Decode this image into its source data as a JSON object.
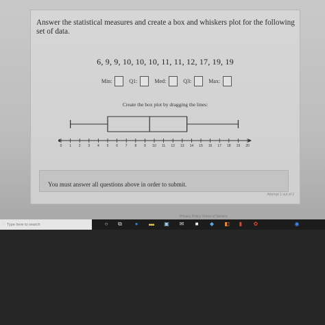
{
  "question": {
    "prompt": "Answer the statistical measures and create a box and whiskers plot for the following set of data.",
    "dataset": "6, 9, 9, 10, 10, 10, 11, 11, 12, 17, 19, 19"
  },
  "measures": {
    "min_label": "Min:",
    "q1_label": "Q1:",
    "med_label": "Med:",
    "q3_label": "Q3:",
    "max_label": "Max:",
    "min_value": "",
    "q1_value": "",
    "med_value": "",
    "q3_value": "",
    "max_value": ""
  },
  "plot": {
    "instruction": "Create the box plot by dragging the lines:",
    "axis_min": 0,
    "axis_max": 20,
    "ticks": [
      "0",
      "1",
      "2",
      "3",
      "4",
      "5",
      "6",
      "7",
      "8",
      "9",
      "10",
      "11",
      "12",
      "13",
      "14",
      "15",
      "16",
      "17",
      "18",
      "19",
      "20"
    ],
    "whisker_min": 1,
    "q1": 5,
    "median": 9.5,
    "q3": 13.5,
    "whisker_max": 19
  },
  "notice": {
    "text": "You must answer all questions above in order to submit."
  },
  "attempt": "Attempt 1 out of 2",
  "footer": "Privacy Policy   Terms of Service",
  "taskbar": {
    "search_placeholder": "Type here to search",
    "icons": [
      "windows-icon",
      "search-icon",
      "cortana-icon",
      "task-view-icon",
      "edge-icon",
      "file-explorer-icon",
      "store-icon",
      "mail-icon",
      "dropbox-icon",
      "app-icon",
      "office-icon",
      "app-icon-2",
      "chrome-icon"
    ]
  },
  "colors": {
    "accent_edge": "#2f7bd6",
    "chrome": "#4285f4"
  }
}
